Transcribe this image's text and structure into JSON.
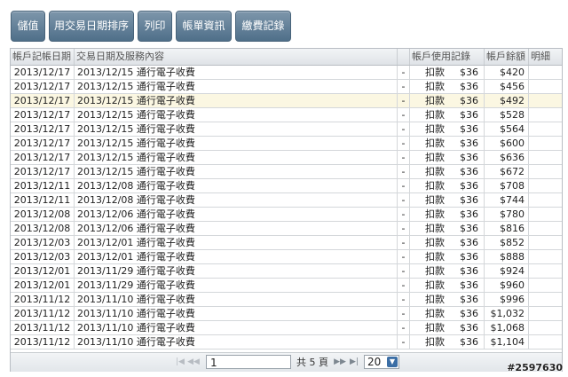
{
  "toolbar": {
    "buttons": [
      "儲值",
      "用交易日期排序",
      "列印",
      "帳單資訊",
      "繳費記錄"
    ]
  },
  "table": {
    "headers": [
      "帳戶記帳日期",
      "交易日期及服務內容",
      "",
      "帳戶使用記錄",
      "帳戶餘額",
      "明細"
    ],
    "rows": [
      [
        "2013/12/17",
        "2013/12/15 通行電子收費",
        "-",
        "扣款",
        "$36",
        "$420",
        ""
      ],
      [
        "2013/12/17",
        "2013/12/15 通行電子收費",
        "-",
        "扣款",
        "$36",
        "$456",
        ""
      ],
      [
        "2013/12/17",
        "2013/12/15 通行電子收費",
        "-",
        "扣款",
        "$36",
        "$492",
        ""
      ],
      [
        "2013/12/17",
        "2013/12/15 通行電子收費",
        "-",
        "扣款",
        "$36",
        "$528",
        ""
      ],
      [
        "2013/12/17",
        "2013/12/15 通行電子收費",
        "-",
        "扣款",
        "$36",
        "$564",
        ""
      ],
      [
        "2013/12/17",
        "2013/12/15 通行電子收費",
        "-",
        "扣款",
        "$36",
        "$600",
        ""
      ],
      [
        "2013/12/17",
        "2013/12/15 通行電子收費",
        "-",
        "扣款",
        "$36",
        "$636",
        ""
      ],
      [
        "2013/12/17",
        "2013/12/15 通行電子收費",
        "-",
        "扣款",
        "$36",
        "$672",
        ""
      ],
      [
        "2013/12/11",
        "2013/12/08 通行電子收費",
        "-",
        "扣款",
        "$36",
        "$708",
        ""
      ],
      [
        "2013/12/11",
        "2013/12/08 通行電子收費",
        "-",
        "扣款",
        "$36",
        "$744",
        ""
      ],
      [
        "2013/12/08",
        "2013/12/06 通行電子收費",
        "-",
        "扣款",
        "$36",
        "$780",
        ""
      ],
      [
        "2013/12/08",
        "2013/12/06 通行電子收費",
        "-",
        "扣款",
        "$36",
        "$816",
        ""
      ],
      [
        "2013/12/03",
        "2013/12/01 通行電子收費",
        "-",
        "扣款",
        "$36",
        "$852",
        ""
      ],
      [
        "2013/12/03",
        "2013/12/01 通行電子收費",
        "-",
        "扣款",
        "$36",
        "$888",
        ""
      ],
      [
        "2013/12/01",
        "2013/11/29 通行電子收費",
        "-",
        "扣款",
        "$36",
        "$924",
        ""
      ],
      [
        "2013/12/01",
        "2013/11/29 通行電子收費",
        "-",
        "扣款",
        "$36",
        "$960",
        ""
      ],
      [
        "2013/11/12",
        "2013/11/10 通行電子收費",
        "-",
        "扣款",
        "$36",
        "$996",
        ""
      ],
      [
        "2013/11/12",
        "2013/11/10 通行電子收費",
        "-",
        "扣款",
        "$36",
        "$1,032",
        ""
      ],
      [
        "2013/11/12",
        "2013/11/10 通行電子收費",
        "-",
        "扣款",
        "$36",
        "$1,068",
        ""
      ],
      [
        "2013/11/12",
        "2013/11/10 通行電子收費",
        "-",
        "扣款",
        "$36",
        "$1,104",
        ""
      ]
    ],
    "highlighted_row": 2
  },
  "pager": {
    "page_value": "1",
    "total_label": "共 5 頁",
    "page_size": "20",
    "icons": [
      "first-page-icon",
      "prev-page-icon",
      "next-page-icon",
      "last-page-icon"
    ]
  },
  "watermark": "#2597630"
}
